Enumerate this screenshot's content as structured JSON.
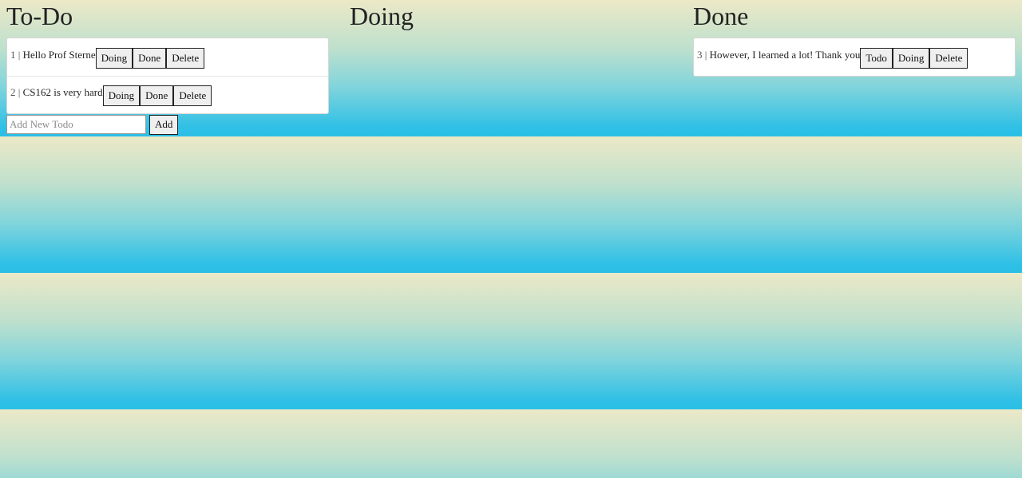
{
  "columns": {
    "todo": {
      "title": "To-Do",
      "cards": [
        {
          "num": "1",
          "sep": " | ",
          "text": "Hello Prof Sterne",
          "buttons": [
            "Doing",
            "Done",
            "Delete"
          ]
        },
        {
          "num": "2",
          "sep": " | ",
          "text": "CS162 is very hard",
          "buttons": [
            "Doing",
            "Done",
            "Delete"
          ]
        }
      ],
      "add_input_placeholder": "Add New Todo",
      "add_button_label": "Add"
    },
    "doing": {
      "title": "Doing",
      "cards": []
    },
    "done": {
      "title": "Done",
      "cards": [
        {
          "num": "3",
          "sep": " | ",
          "text": "However, I learned a lot! Thank you",
          "buttons": [
            "Todo",
            "Doing",
            "Delete"
          ]
        }
      ]
    }
  },
  "colors": {
    "gradient_top": "#ece9c7",
    "gradient_bottom": "#2bbfe6",
    "card_bg": "#ffffff",
    "button_bg": "#efefef"
  }
}
